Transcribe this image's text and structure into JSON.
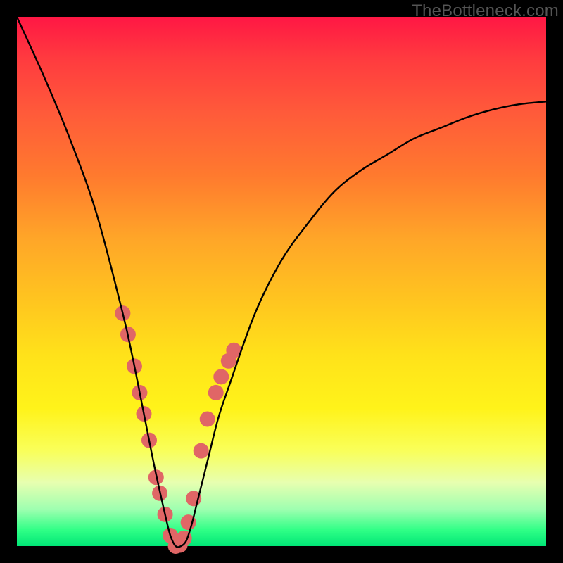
{
  "watermark": "TheBottleneck.com",
  "chart_data": {
    "type": "line",
    "title": "",
    "xlabel": "",
    "ylabel": "",
    "xlim": [
      0,
      100
    ],
    "ylim": [
      0,
      100
    ],
    "grid": false,
    "legend": false,
    "series": [
      {
        "name": "bottleneck-curve",
        "x": [
          0,
          5,
          10,
          15,
          20,
          22,
          24,
          26,
          28,
          29,
          30,
          31,
          32,
          33,
          34,
          36,
          38,
          40,
          45,
          50,
          55,
          60,
          65,
          70,
          75,
          80,
          85,
          90,
          95,
          100
        ],
        "y": [
          100,
          89,
          77,
          63,
          44,
          35,
          25,
          15,
          6,
          2,
          0,
          0,
          1,
          4,
          8,
          16,
          24,
          30,
          44,
          54,
          61,
          67,
          71,
          74,
          77,
          79,
          81,
          82.5,
          83.5,
          84
        ]
      }
    ],
    "markers": {
      "name": "highlight-points",
      "color": "#e06666",
      "radius_px": 11,
      "x": [
        20.0,
        21.0,
        22.2,
        23.2,
        24.0,
        25.0,
        26.3,
        27.0,
        28.0,
        29.0,
        30.0,
        30.8,
        31.6,
        32.4,
        33.4,
        34.8,
        36.0,
        37.6,
        38.6,
        40.0,
        41.0
      ],
      "y": [
        44.0,
        40.0,
        34.0,
        29.0,
        25.0,
        20.0,
        13.0,
        10.0,
        6.0,
        2.0,
        0.0,
        0.2,
        1.5,
        4.5,
        9.0,
        18.0,
        24.0,
        29.0,
        32.0,
        35.0,
        37.0
      ]
    },
    "gradient_stops": [
      {
        "pos": 0.0,
        "color": "#ff1744"
      },
      {
        "pos": 0.18,
        "color": "#ff5a3a"
      },
      {
        "pos": 0.42,
        "color": "#ffa628"
      },
      {
        "pos": 0.64,
        "color": "#ffe21a"
      },
      {
        "pos": 0.82,
        "color": "#f9ff5a"
      },
      {
        "pos": 0.93,
        "color": "#9fffb0"
      },
      {
        "pos": 1.0,
        "color": "#00e676"
      }
    ]
  }
}
